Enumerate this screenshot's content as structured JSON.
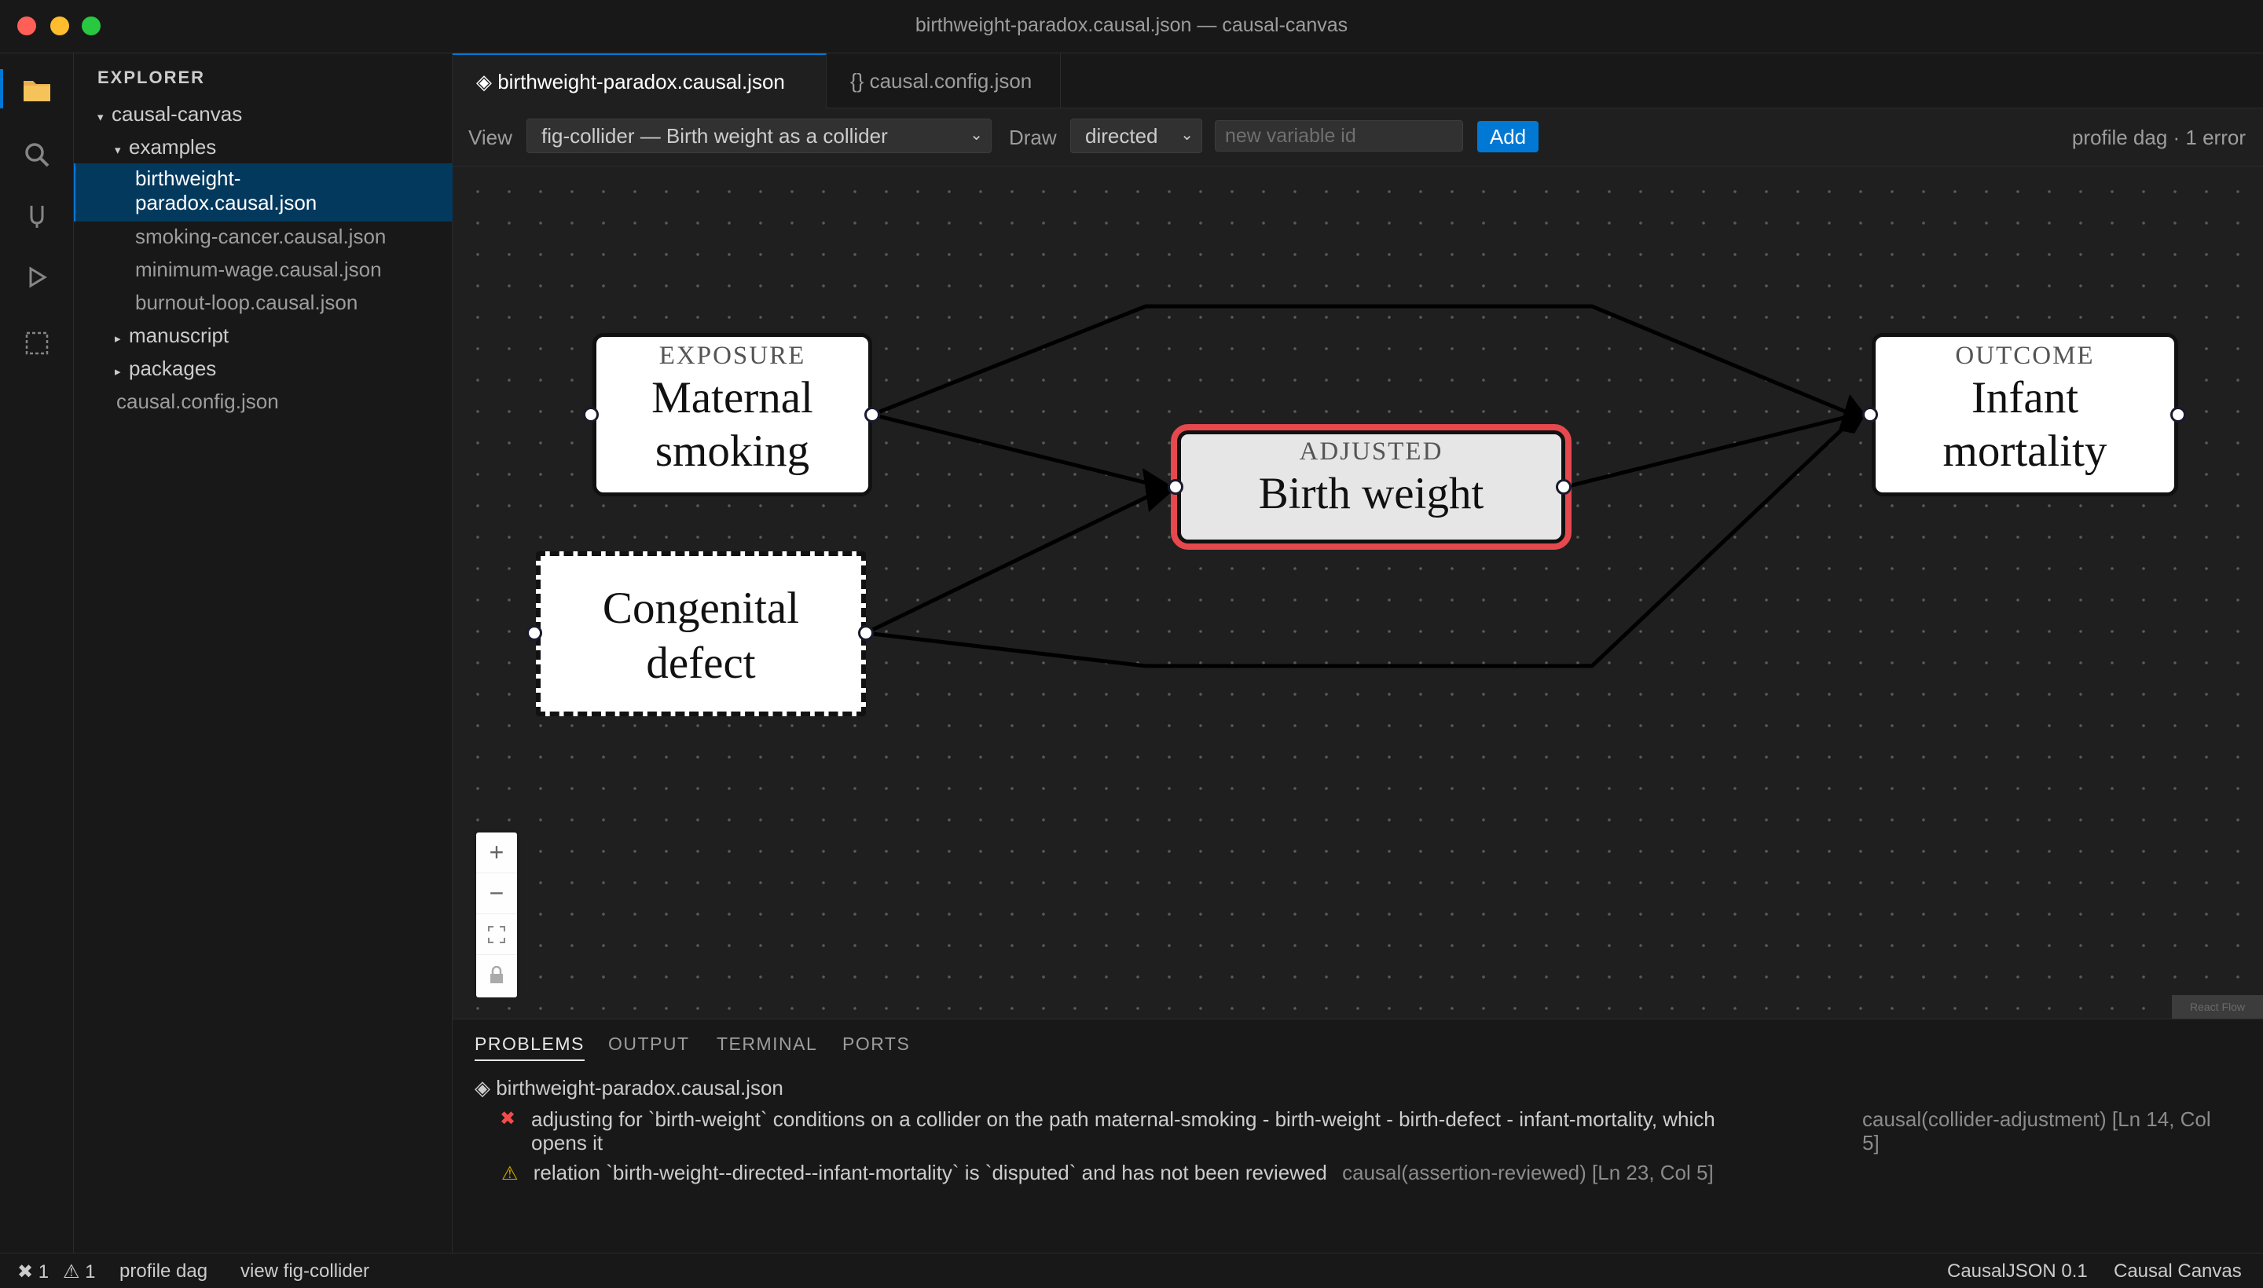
{
  "window": {
    "title": "birthweight-paradox.causal.json — causal-canvas",
    "traffic_colors": [
      "#ff5f57",
      "#febc2e",
      "#28c840"
    ]
  },
  "activity_bar": {
    "icons": [
      "files-icon",
      "search-icon",
      "source-control-icon",
      "run-icon",
      "extensions-icon"
    ]
  },
  "explorer": {
    "title": "EXPLORER",
    "root": "causal-canvas",
    "folder_examples": "examples",
    "files_examples": [
      "birthweight-paradox.causal.json",
      "smoking-cancer.causal.json",
      "minimum-wage.causal.json",
      "burnout-loop.causal.json"
    ],
    "selected_line1": "birthweight-",
    "selected_line2": "paradox.causal.json",
    "folder_manuscript": "manuscript",
    "folder_packages": "packages",
    "root_file": "causal.config.json"
  },
  "tabs": [
    {
      "label": "◈ birthweight-paradox.causal.json",
      "active": true
    },
    {
      "label": "{} causal.config.json",
      "active": false
    }
  ],
  "toolbar": {
    "view_label": "View",
    "view_value": "fig-collider — Birth weight as a collider",
    "draw_label": "Draw",
    "draw_value": "directed",
    "var_placeholder": "new variable id",
    "add_label": "Add",
    "status": "profile dag · 1 error"
  },
  "diagram": {
    "nodes": {
      "exposure": {
        "role": "EXPOSURE",
        "line1": "Maternal",
        "line2": "smoking"
      },
      "adjusted": {
        "role": "ADJUSTED",
        "label": "Birth weight"
      },
      "congenital": {
        "line1": "Congenital",
        "line2": "defect"
      },
      "outcome": {
        "role": "OUTCOME",
        "line1": "Infant",
        "line2": "mortality"
      }
    },
    "edge_color": "#000000",
    "adjusted_border_color": "#e5484d",
    "attribution": "React Flow"
  },
  "panel": {
    "tabs": [
      "PROBLEMS",
      "OUTPUT",
      "TERMINAL",
      "PORTS"
    ],
    "file": "◈ birthweight-paradox.causal.json",
    "problems": [
      {
        "severity": "error",
        "icon": "✖",
        "message_line1": "adjusting for `birth-weight` conditions on a collider on the path maternal-smoking - birth-weight - birth-defect - infant-mortality, which",
        "message_line2": "opens it",
        "source_line1": "causal(collider-adjustment) [Ln 14, Col",
        "source_line2": "5]"
      },
      {
        "severity": "warning",
        "icon": "⚠",
        "message": "relation `birth-weight--directed--infant-mortality` is `disputed` and has not been reviewed",
        "source": "causal(assertion-reviewed) [Ln 23, Col 5]"
      }
    ]
  },
  "statusbar": {
    "errors": "✖ 1",
    "warnings": "⚠ 1",
    "profile": "profile dag",
    "view": "view fig-collider",
    "language": "CausalJSON 0.1",
    "app": "Causal Canvas"
  }
}
